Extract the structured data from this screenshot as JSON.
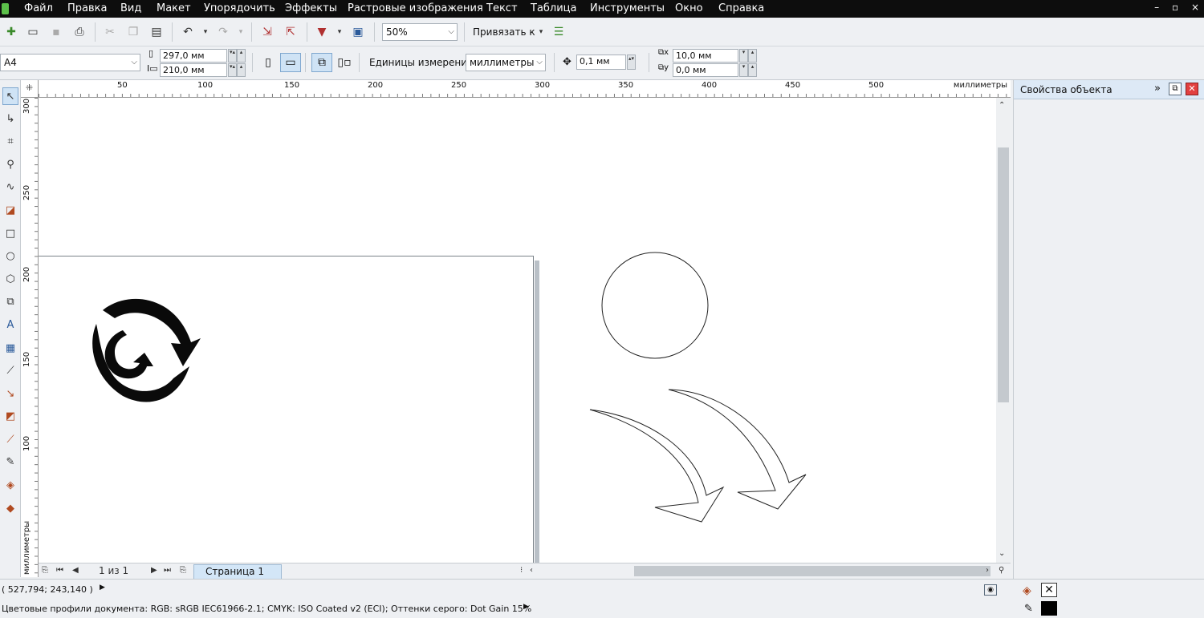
{
  "menu": {
    "items": [
      "Файл",
      "Правка",
      "Вид",
      "Макет",
      "Упорядочить",
      "Эффекты",
      "Растровые изображения",
      "Текст",
      "Таблица",
      "Инструменты",
      "Окно",
      "Справка"
    ],
    "window_controls": [
      "–",
      "▫",
      "×"
    ]
  },
  "toolbar": {
    "zoom_value": "50%",
    "snap_label": "Привязать к"
  },
  "property_bar": {
    "page_size": "A4",
    "width": "297,0 мм",
    "height": "210,0 мм",
    "units_label": "Единицы измерения:",
    "units_value": "миллиметры",
    "nudge": "0,1 мм",
    "dup_x": "10,0 мм",
    "dup_y": "0,0 мм"
  },
  "ruler": {
    "h_ticks": [
      "50",
      "100",
      "150",
      "200",
      "250",
      "300",
      "350",
      "400",
      "450",
      "500"
    ],
    "h_unit": "миллиметры",
    "v_ticks": [
      "300",
      "250",
      "200",
      "150",
      "100"
    ],
    "v_unit": "миллиметры"
  },
  "page_nav": {
    "counter": "1 из 1",
    "tab_label": "Страница 1"
  },
  "docker": {
    "title": "Свойства объекта"
  },
  "status": {
    "coords": "( 527,794; 243,140 )",
    "profiles": "Цветовые профили документа: RGB: sRGB IEC61966-2.1; CMYK: ISO Coated v2 (ECI); Оттенки серого: Dot Gain 15%"
  },
  "colors": {
    "menubar_bg": "#0d0d0d",
    "accent": "#cfe3f5",
    "page_tab": "#d3e6f7"
  }
}
